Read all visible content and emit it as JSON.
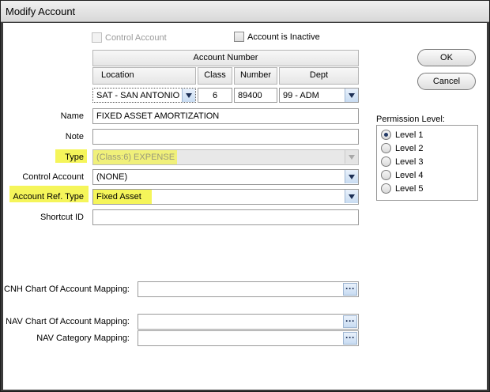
{
  "window": {
    "title": "Modify Account"
  },
  "checkboxes": {
    "control_account": "Control Account",
    "account_inactive": "Account is Inactive"
  },
  "account_number": {
    "header": "Account Number",
    "columns": {
      "location": "Location",
      "class": "Class",
      "number": "Number",
      "dept": "Dept"
    },
    "values": {
      "location": "SAT - SAN ANTONIO",
      "class": "6",
      "number": "89400",
      "dept": "99 - ADM"
    }
  },
  "fields": {
    "name": {
      "label": "Name",
      "value": "FIXED ASSET AMORTIZATION"
    },
    "note": {
      "label": "Note",
      "value": ""
    },
    "type": {
      "label": "Type",
      "value": "(Class:6) EXPENSE"
    },
    "control_account": {
      "label": "Control Account",
      "value": "(NONE)"
    },
    "account_ref_type": {
      "label": "Account Ref. Type",
      "value": "Fixed Asset"
    },
    "shortcut_id": {
      "label": "Shortcut ID",
      "value": ""
    },
    "cnh_mapping": {
      "label": "CNH Chart Of Account Mapping:",
      "value": ""
    },
    "nav_mapping": {
      "label": "NAV Chart Of Account Mapping:",
      "value": ""
    },
    "nav_category": {
      "label": "NAV Category Mapping:",
      "value": ""
    }
  },
  "buttons": {
    "ok": "OK",
    "cancel": "Cancel"
  },
  "permission": {
    "label": "Permission Level:",
    "levels": [
      "Level 1",
      "Level 2",
      "Level 3",
      "Level 4",
      "Level 5"
    ],
    "selected": "Level 1"
  },
  "colors": {
    "highlight": "#f5f55a",
    "dropdown_accent": "#c8dcf2"
  }
}
